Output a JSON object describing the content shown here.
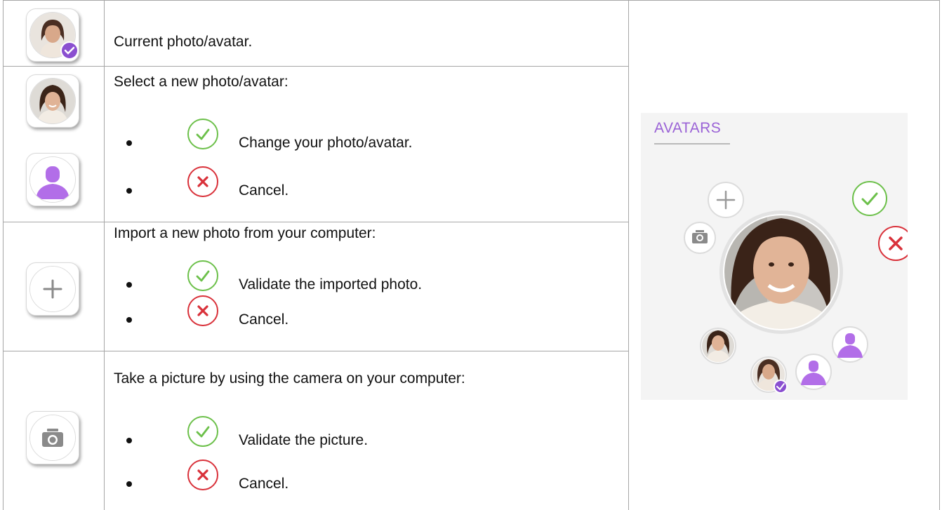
{
  "rows": [
    {
      "description": "Current photo/avatar.",
      "thumb_icon": "current-avatar-checked-icon"
    },
    {
      "description": "Select a new photo/avatar:",
      "thumb_icons": [
        "photo-avatar-icon",
        "person-silhouette-icon"
      ],
      "bullets": [
        {
          "icon": "check-circle-icon",
          "text": "Change your photo/avatar."
        },
        {
          "icon": "cross-circle-icon",
          "text": "Cancel."
        }
      ]
    },
    {
      "description": "Import a new photo from your computer:",
      "thumb_icon": "plus-icon",
      "bullets": [
        {
          "icon": "check-circle-icon",
          "text": "Validate the imported photo."
        },
        {
          "icon": "cross-circle-icon",
          "text": "Cancel."
        }
      ]
    },
    {
      "description": "Take a picture by using the camera on your computer:",
      "thumb_icon": "camera-icon",
      "bullets": [
        {
          "icon": "check-circle-icon",
          "text": "Validate the picture."
        },
        {
          "icon": "cross-circle-icon",
          "text": "Cancel."
        }
      ]
    }
  ],
  "avatars_panel": {
    "title": "AVATARS",
    "accent_color": "#9a62d6",
    "confirm_color": "#5cb85c",
    "cancel_color": "#d9313a"
  }
}
